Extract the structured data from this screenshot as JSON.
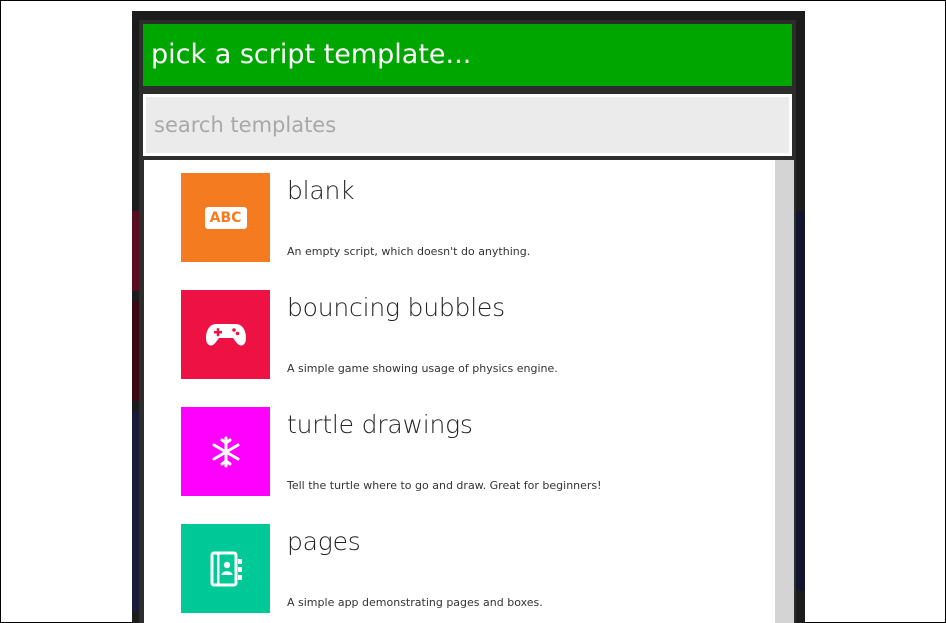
{
  "dialog": {
    "title": "pick a script template...",
    "colors": {
      "header": "#00a600",
      "scrollbar": "#d4d4d4"
    }
  },
  "search": {
    "value": "",
    "placeholder": "search templates"
  },
  "templates": [
    {
      "title": "blank",
      "description": "An empty script, which doesn't do anything.",
      "icon": "abc-icon",
      "color": "#f47b20",
      "icon_text": "ABC"
    },
    {
      "title": "bouncing bubbles",
      "description": "A simple game showing usage of physics engine.",
      "icon": "gamepad-icon",
      "color": "#ee1144"
    },
    {
      "title": "turtle drawings",
      "description": "Tell the turtle where to go and draw. Great for beginners!",
      "icon": "snowflake-icon",
      "color": "#ff00ff"
    },
    {
      "title": "pages",
      "description": "A simple app demonstrating pages and boxes.",
      "icon": "contact-book-icon",
      "color": "#00c896"
    }
  ]
}
